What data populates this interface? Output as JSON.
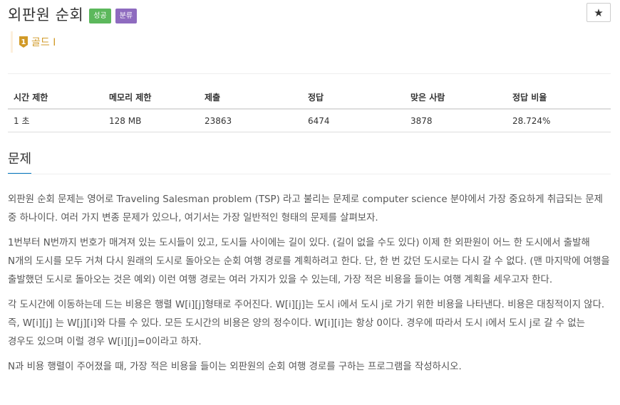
{
  "problem": {
    "title": "외판원 순회",
    "badges": {
      "success": "성공",
      "category": "분류"
    },
    "tier": {
      "label": "골드 I",
      "number": "1",
      "color": "#d19a28"
    },
    "star": "★"
  },
  "stats": {
    "headers": [
      "시간 제한",
      "메모리 제한",
      "제출",
      "정답",
      "맞은 사람",
      "정답 비율"
    ],
    "values": [
      "1 초",
      "128 MB",
      "23863",
      "6474",
      "3878",
      "28.724%"
    ]
  },
  "section": {
    "title": "문제"
  },
  "description": [
    "외판원 순회 문제는 영어로 Traveling Salesman problem (TSP) 라고 불리는 문제로 computer science 분야에서 가장 중요하게 취급되는 문제 중 하나이다. 여러 가지 변종 문제가 있으나, 여기서는 가장 일반적인 형태의 문제를 살펴보자.",
    "1번부터 N번까지 번호가 매겨져 있는 도시들이 있고, 도시들 사이에는 길이 있다. (길이 없을 수도 있다) 이제 한 외판원이 어느 한 도시에서 출발해 N개의 도시를 모두 거쳐 다시 원래의 도시로 돌아오는 순회 여행 경로를 계획하려고 한다. 단, 한 번 갔던 도시로는 다시 갈 수 없다. (맨 마지막에 여행을 출발했던 도시로 돌아오는 것은 예외) 이런 여행 경로는 여러 가지가 있을 수 있는데, 가장 적은 비용을 들이는 여행 계획을 세우고자 한다.",
    "각 도시간에 이동하는데 드는 비용은 행렬 W[i][j]형태로 주어진다. W[i][j]는 도시 i에서 도시 j로 가기 위한 비용을 나타낸다. 비용은 대칭적이지 않다. 즉, W[i][j] 는 W[j][i]와 다를 수 있다. 모든 도시간의 비용은 양의 정수이다. W[i][i]는 항상 0이다. 경우에 따라서 도시 i에서 도시 j로 갈 수 없는 경우도 있으며 이럴 경우 W[i][j]=0이라고 하자.",
    "N과 비용 행렬이 주어졌을 때, 가장 적은 비용을 들이는 외판원의 순회 여행 경로를 구하는 프로그램을 작성하시오."
  ]
}
